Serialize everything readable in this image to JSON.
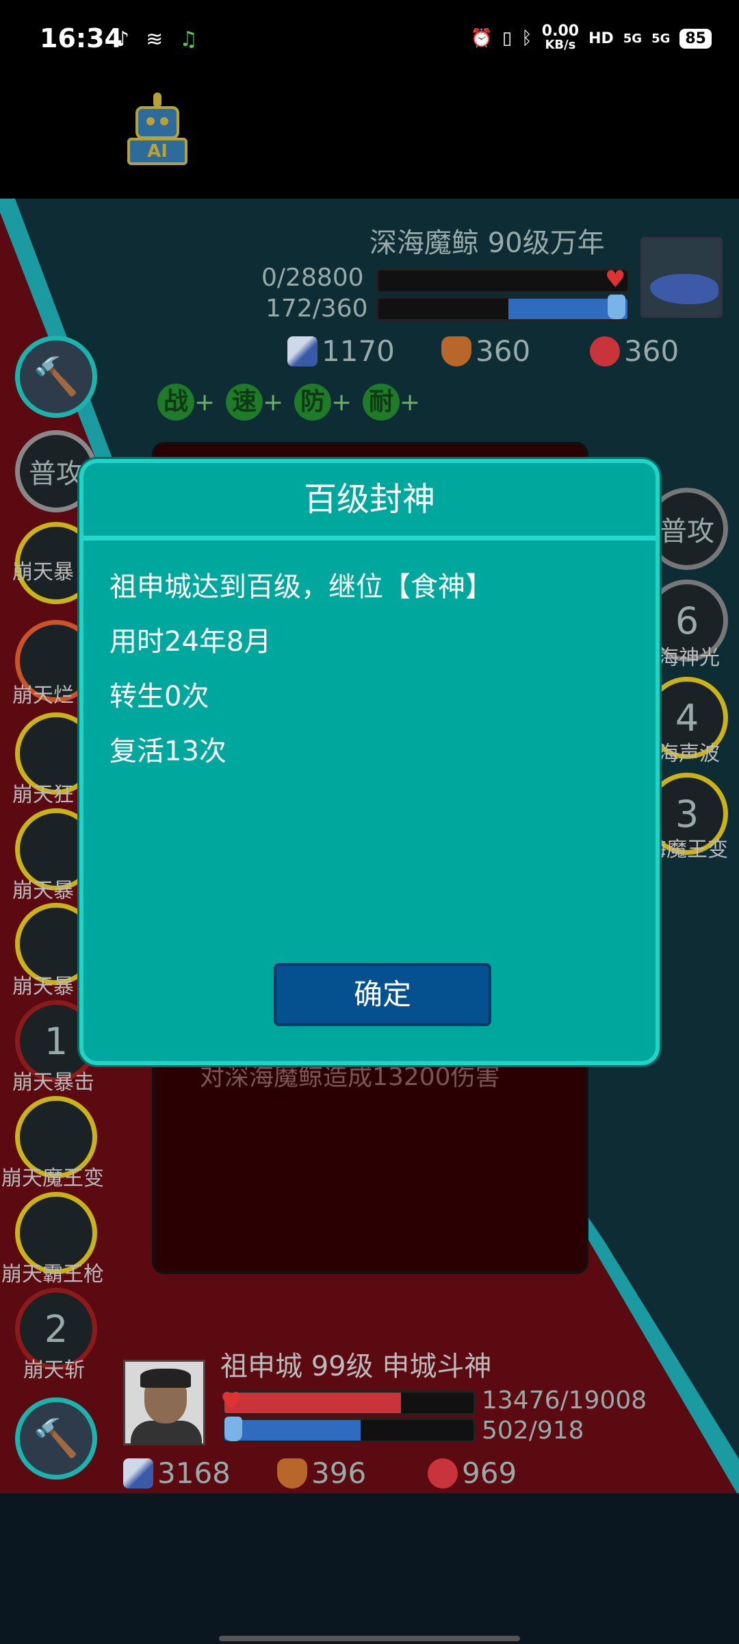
{
  "status_bar": {
    "time": "16:34",
    "net_speed": "0.00",
    "net_unit": "KB/s",
    "signal_1": "5G",
    "signal_2": "5G",
    "battery": "85"
  },
  "ai_button": {
    "label": "AI"
  },
  "enemy": {
    "title": "深海魔鲸 90级万年",
    "hp": "0/28800",
    "hp_fraction": 0.0,
    "mp": "172/360",
    "mp_fraction": 0.478,
    "attack": "1170",
    "defense": "360",
    "health": "360",
    "skills": [
      {
        "label": "普攻",
        "count": ""
      },
      {
        "label": "海神光",
        "count": "6"
      },
      {
        "label": "海声波",
        "count": "4"
      },
      {
        "label": "海魔王变",
        "count": "3"
      }
    ]
  },
  "buffs": [
    {
      "char": "战",
      "suffix": "+"
    },
    {
      "char": "速",
      "suffix": "+"
    },
    {
      "char": "防",
      "suffix": "+"
    },
    {
      "char": "耐",
      "suffix": "+"
    }
  ],
  "player_skills": [
    {
      "label": "普攻",
      "count": ""
    },
    {
      "label": "崩天暴",
      "count": ""
    },
    {
      "label": "崩天烂",
      "count": ""
    },
    {
      "label": "崩天狂",
      "count": ""
    },
    {
      "label": "崩天暴",
      "count": ""
    },
    {
      "label": "崩天暴",
      "count": ""
    },
    {
      "label": "崩天暴击",
      "count": "1"
    },
    {
      "label": "崩天魔王变",
      "count": ""
    },
    {
      "label": "崩天霸王枪",
      "count": ""
    },
    {
      "label": "崩天斩",
      "count": "2"
    }
  ],
  "battle_log": {
    "last_line": "对深海魔鲸造成13200伤害"
  },
  "player": {
    "title": "祖申城 99级 申城斗神",
    "hp": "13476/19008",
    "hp_fraction": 0.709,
    "mp": "502/918",
    "mp_fraction": 0.547,
    "attack": "3168",
    "defense": "396",
    "health": "969"
  },
  "dialog": {
    "title": "百级封神",
    "lines": [
      "祖申城达到百级，继位【食神】",
      "用时24年8月",
      "转生0次",
      "复活13次"
    ],
    "confirm_label": "确定"
  }
}
